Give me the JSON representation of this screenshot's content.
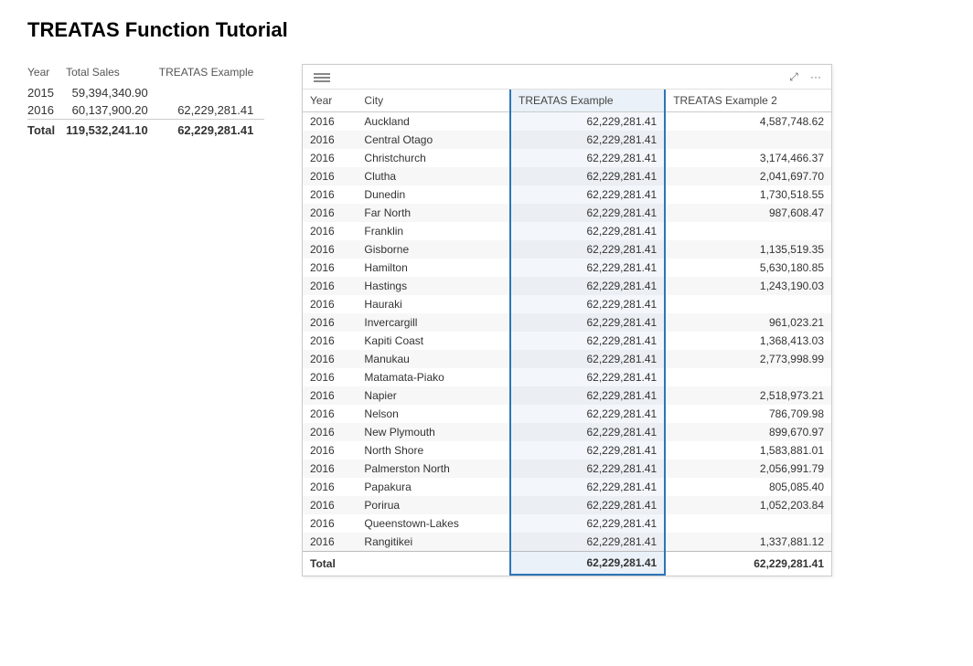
{
  "page": {
    "title": "TREATAS Function Tutorial"
  },
  "left_table": {
    "headers": [
      "Year",
      "Total Sales",
      "TREATAS Example"
    ],
    "rows": [
      {
        "year": "2015",
        "total_sales": "59,394,340.90",
        "treatas": ""
      },
      {
        "year": "2016",
        "total_sales": "60,137,900.20",
        "treatas": "62,229,281.41"
      }
    ],
    "total_row": {
      "label": "Total",
      "total_sales": "119,532,241.10",
      "treatas": "62,229,281.41"
    }
  },
  "right_table": {
    "headers": [
      "Year",
      "City",
      "TREATAS Example",
      "TREATAS Example 2"
    ],
    "rows": [
      {
        "year": "2016",
        "city": "Auckland",
        "ex1": "62,229,281.41",
        "ex2": "4,587,748.62"
      },
      {
        "year": "2016",
        "city": "Central Otago",
        "ex1": "62,229,281.41",
        "ex2": ""
      },
      {
        "year": "2016",
        "city": "Christchurch",
        "ex1": "62,229,281.41",
        "ex2": "3,174,466.37"
      },
      {
        "year": "2016",
        "city": "Clutha",
        "ex1": "62,229,281.41",
        "ex2": "2,041,697.70"
      },
      {
        "year": "2016",
        "city": "Dunedin",
        "ex1": "62,229,281.41",
        "ex2": "1,730,518.55"
      },
      {
        "year": "2016",
        "city": "Far North",
        "ex1": "62,229,281.41",
        "ex2": "987,608.47"
      },
      {
        "year": "2016",
        "city": "Franklin",
        "ex1": "62,229,281.41",
        "ex2": ""
      },
      {
        "year": "2016",
        "city": "Gisborne",
        "ex1": "62,229,281.41",
        "ex2": "1,135,519.35"
      },
      {
        "year": "2016",
        "city": "Hamilton",
        "ex1": "62,229,281.41",
        "ex2": "5,630,180.85"
      },
      {
        "year": "2016",
        "city": "Hastings",
        "ex1": "62,229,281.41",
        "ex2": "1,243,190.03"
      },
      {
        "year": "2016",
        "city": "Hauraki",
        "ex1": "62,229,281.41",
        "ex2": ""
      },
      {
        "year": "2016",
        "city": "Invercargill",
        "ex1": "62,229,281.41",
        "ex2": "961,023.21"
      },
      {
        "year": "2016",
        "city": "Kapiti Coast",
        "ex1": "62,229,281.41",
        "ex2": "1,368,413.03"
      },
      {
        "year": "2016",
        "city": "Manukau",
        "ex1": "62,229,281.41",
        "ex2": "2,773,998.99"
      },
      {
        "year": "2016",
        "city": "Matamata-Piako",
        "ex1": "62,229,281.41",
        "ex2": ""
      },
      {
        "year": "2016",
        "city": "Napier",
        "ex1": "62,229,281.41",
        "ex2": "2,518,973.21"
      },
      {
        "year": "2016",
        "city": "Nelson",
        "ex1": "62,229,281.41",
        "ex2": "786,709.98"
      },
      {
        "year": "2016",
        "city": "New Plymouth",
        "ex1": "62,229,281.41",
        "ex2": "899,670.97"
      },
      {
        "year": "2016",
        "city": "North Shore",
        "ex1": "62,229,281.41",
        "ex2": "1,583,881.01"
      },
      {
        "year": "2016",
        "city": "Palmerston North",
        "ex1": "62,229,281.41",
        "ex2": "2,056,991.79"
      },
      {
        "year": "2016",
        "city": "Papakura",
        "ex1": "62,229,281.41",
        "ex2": "805,085.40"
      },
      {
        "year": "2016",
        "city": "Porirua",
        "ex1": "62,229,281.41",
        "ex2": "1,052,203.84"
      },
      {
        "year": "2016",
        "city": "Queenstown-Lakes",
        "ex1": "62,229,281.41",
        "ex2": ""
      },
      {
        "year": "2016",
        "city": "Rangitikei",
        "ex1": "62,229,281.41",
        "ex2": "1,337,881.12"
      }
    ],
    "total_row": {
      "label": "Total",
      "ex1": "62,229,281.41",
      "ex2": "62,229,281.41"
    }
  },
  "icons": {
    "menu_lines": "≡",
    "expand": "⤢",
    "more": "···"
  }
}
